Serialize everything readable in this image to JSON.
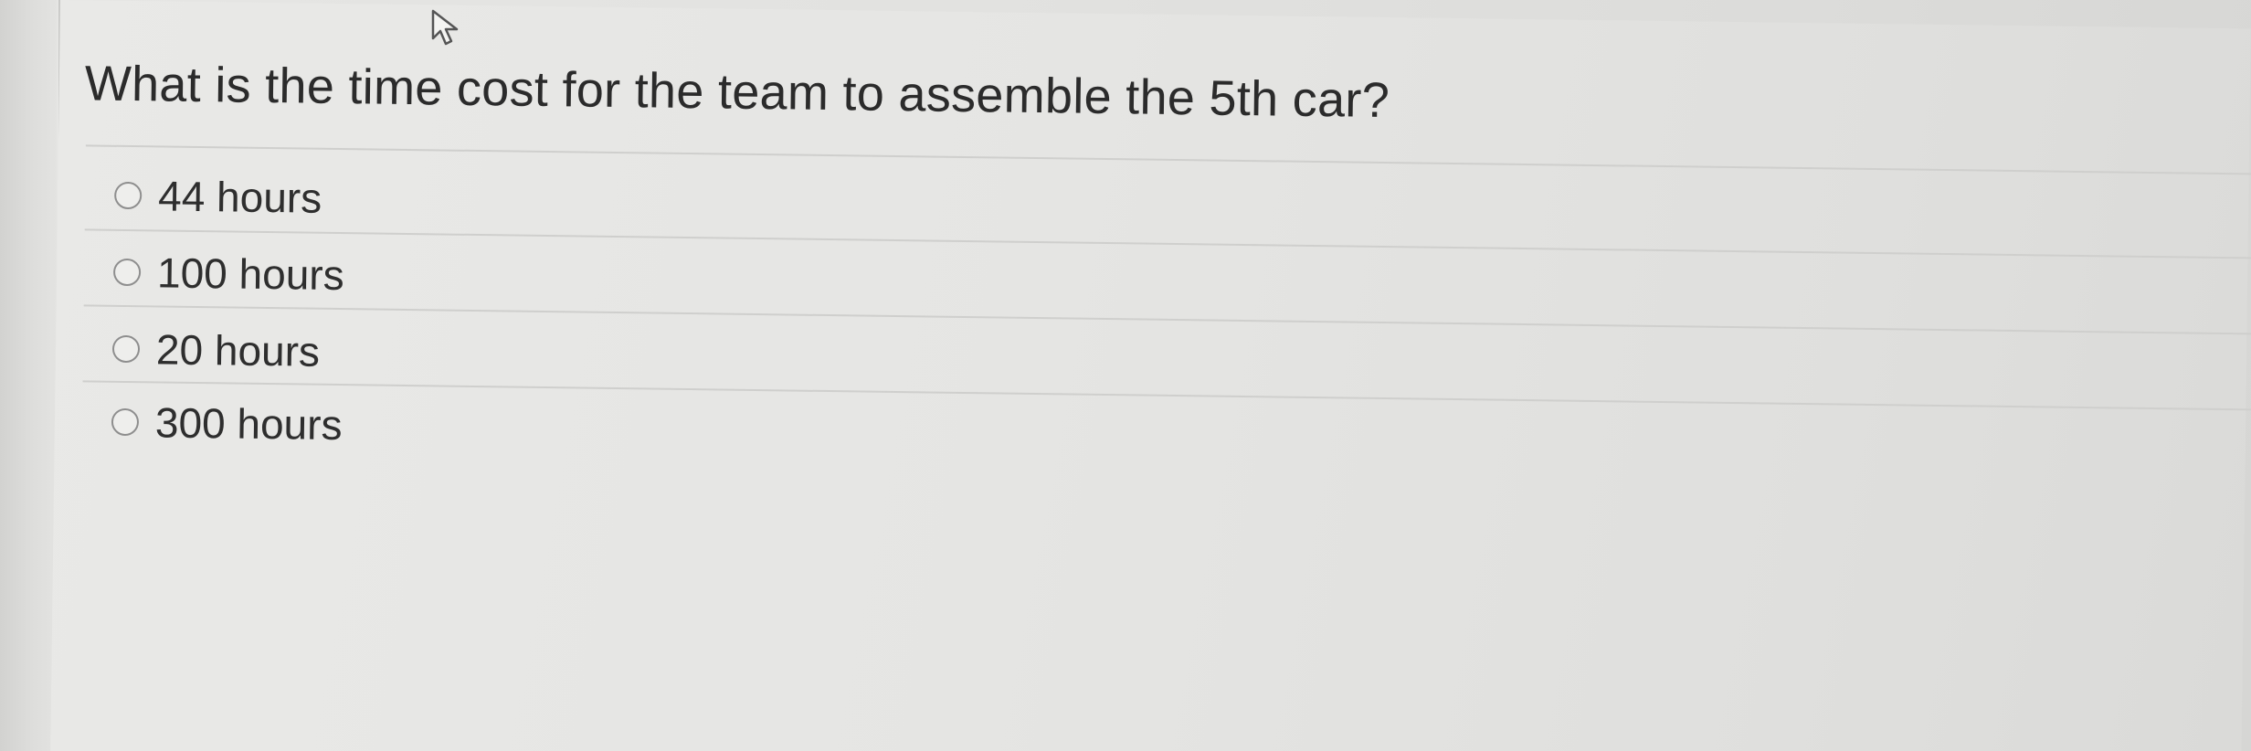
{
  "question": {
    "text": "What is the time cost for the team to assemble the 5th car?"
  },
  "options": [
    {
      "label": "44 hours",
      "selected": false
    },
    {
      "label": "100 hours",
      "selected": false
    },
    {
      "label": "20 hours",
      "selected": false
    },
    {
      "label": "300 hours",
      "selected": false
    }
  ],
  "cursor": {
    "icon": "arrow-pointer-icon"
  }
}
